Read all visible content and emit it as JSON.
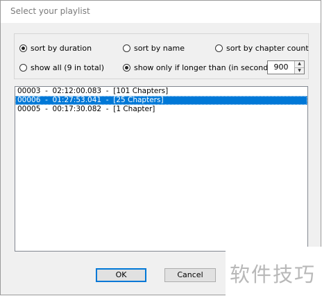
{
  "window": {
    "title": "Select your playlist"
  },
  "sort_options": [
    {
      "label": "sort by duration",
      "selected": true
    },
    {
      "label": "sort by name",
      "selected": false
    },
    {
      "label": "sort by chapter count",
      "selected": false
    }
  ],
  "filter_options": [
    {
      "label": "show all (9 in total)",
      "selected": false
    },
    {
      "label": "show only if longer than (in seconds)",
      "selected": true
    }
  ],
  "min_duration": {
    "value": "900"
  },
  "playlist": {
    "items": [
      {
        "text": "00003  -  02:12:00.083  -  [101 Chapters]",
        "selected": false
      },
      {
        "text": "00006  -  01:27:53.041  -  [25 Chapters]",
        "selected": true
      },
      {
        "text": "00005  -  00:17:30.082  -  [1 Chapter]",
        "selected": false
      }
    ]
  },
  "buttons": {
    "ok": "OK",
    "cancel": "Cancel"
  },
  "watermark": {
    "text": "软件技巧"
  },
  "colors": {
    "selection": "#0078d7",
    "dialog_bg": "#f0f0f0"
  }
}
